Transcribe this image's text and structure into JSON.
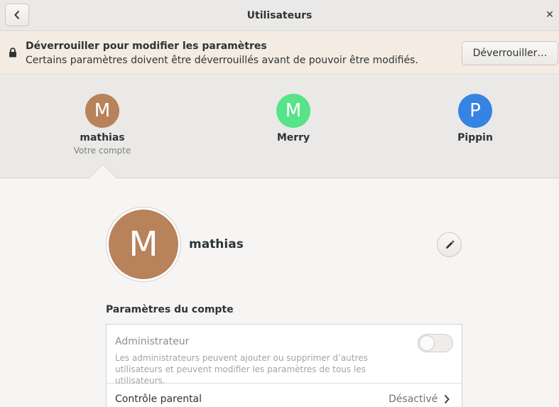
{
  "window": {
    "title": "Utilisateurs"
  },
  "infobar": {
    "title": "Déverrouiller pour modifier les paramètres",
    "subtitle": "Certains paramètres doivent être déverrouillés avant de pouvoir être modifiés.",
    "unlock_label": "Déverrouiller…"
  },
  "users": [
    {
      "initial": "M",
      "name": "mathias",
      "subtitle": "Votre compte",
      "color": "#b8825a"
    },
    {
      "initial": "M",
      "name": "Merry",
      "color": "#57e389"
    },
    {
      "initial": "P",
      "name": "Pippin",
      "color": "#3584e4"
    }
  ],
  "selected_user": {
    "initial": "M",
    "name": "mathias"
  },
  "account_settings": {
    "title": "Paramètres du compte",
    "administrator": {
      "label": "Administrateur",
      "description": "Les administrateurs peuvent ajouter ou supprimer d’autres utilisateurs et peuvent modifier les paramètres de tous les utilisateurs.",
      "enabled": false
    },
    "parental_control": {
      "label": "Contrôle parental",
      "value": "Désactivé"
    }
  },
  "icons": [
    "back-arrow-icon",
    "close-icon",
    "lock-icon",
    "pencil-icon",
    "chevron-right-icon"
  ]
}
